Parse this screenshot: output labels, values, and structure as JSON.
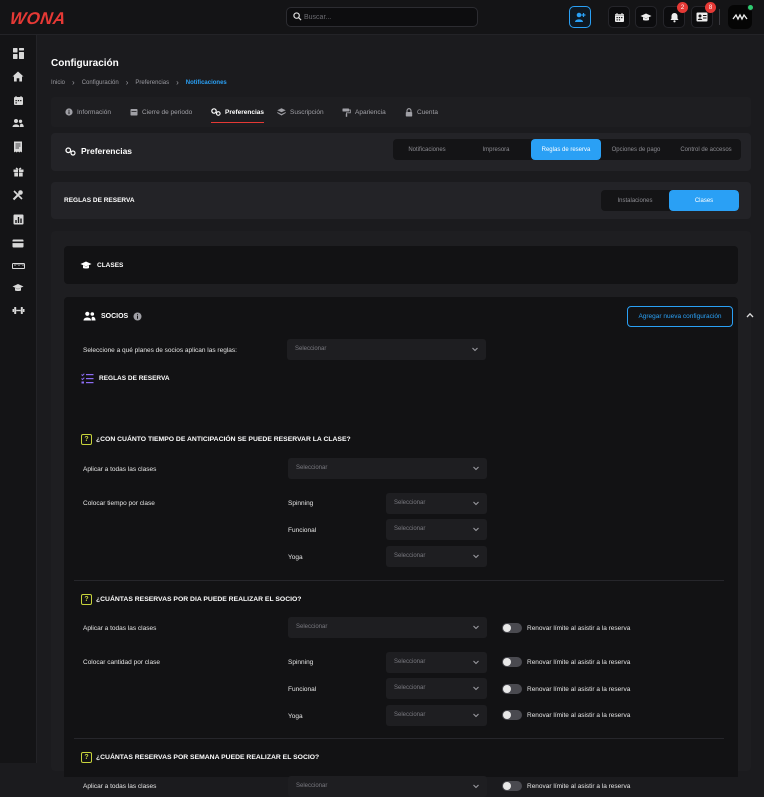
{
  "header": {
    "logo": "WONA",
    "search_placeholder": "Buscar...",
    "badges": {
      "notifications": "2",
      "contacts": "8"
    }
  },
  "colors": {
    "accent": "#2aa0f5",
    "brand": "#e53935",
    "online": "#2ecc71",
    "question": "#c8d43c"
  },
  "sidebar": {
    "icons": [
      "dashboard-icon",
      "home-icon",
      "calendar-icon",
      "users-icon",
      "receipt-icon",
      "gift-icon",
      "tools-icon",
      "report-icon",
      "card-icon",
      "ruler-icon",
      "graduation-icon",
      "dumbbell-icon"
    ]
  },
  "page": {
    "title": "Configuración",
    "breadcrumb": [
      "Inicio",
      "Configuración",
      "Preferencias",
      "Notificaciones"
    ]
  },
  "tabs": [
    {
      "label": "Información",
      "icon": "info-icon"
    },
    {
      "label": "Cierre de periodo",
      "icon": "calendar-icon"
    },
    {
      "label": "Preferencias",
      "icon": "gears-icon",
      "active": true
    },
    {
      "label": "Suscripción",
      "icon": "layers-icon"
    },
    {
      "label": "Apariencia",
      "icon": "brush-icon"
    },
    {
      "label": "Cuenta",
      "icon": "lock-icon"
    }
  ],
  "preferences": {
    "title": "Preferencias",
    "segments": [
      "Notificaciones",
      "Impresora",
      "Reglas de reserva",
      "Opciones de pago",
      "Control de accesos"
    ],
    "active_segment": "Reglas de reserva"
  },
  "booking": {
    "title": "REGLAS DE RESERVA",
    "segments": [
      "Instalaciones",
      "Clases"
    ],
    "active_segment": "Clases"
  },
  "clases": {
    "title": "CLASES"
  },
  "socios": {
    "title": "SOCIOS",
    "add_button": "Agregar nueva configuración",
    "plans_label": "Seleccione a qué planes de socios aplican las reglas:",
    "select_placeholder": "Seleccionar",
    "rules_title": "REGLAS DE RESERVA",
    "classes": [
      "Spinning",
      "Funcional",
      "Yoga"
    ],
    "renew_label": "Renovar límite al asistir a la reserva",
    "q1": {
      "title": "¿CON CUÁNTO TIEMPO DE ANTICIPACIÓN SE PUEDE RESERVAR LA CLASE?",
      "apply_all": "Aplicar a todas las clases",
      "per_class": "Colocar tiempo por clase"
    },
    "q2": {
      "title": "¿CUÁNTAS RESERVAS POR DIA PUEDE REALIZAR EL SOCIO?",
      "apply_all": "Aplicar a todas las clases",
      "per_class": "Colocar cantidad por clase"
    },
    "q3": {
      "title": "¿CUÁNTAS RESERVAS POR SEMANA PUEDE REALIZAR EL SOCIO?",
      "apply_all": "Aplicar a todas las clases"
    }
  }
}
